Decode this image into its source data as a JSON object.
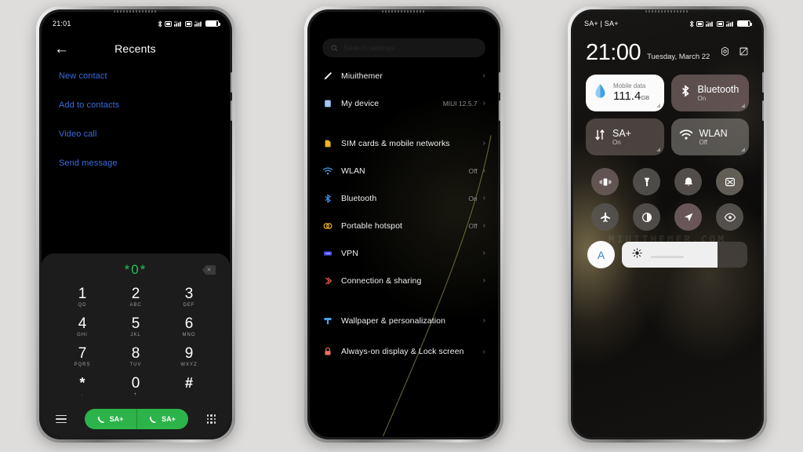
{
  "background_color": "#dedddb",
  "watermark": "MIUITHEMER.COM",
  "phone1": {
    "name": "dialer-recents-screen",
    "statusbar": {
      "time": "21:01",
      "icons": [
        "bluetooth-icon",
        "sim-icon",
        "signal-4g-icon",
        "sim-icon",
        "signal-4g-icon",
        "battery-icon"
      ]
    },
    "header": {
      "back": "←",
      "title": "Recents"
    },
    "links": [
      {
        "label": "New contact"
      },
      {
        "label": "Add to contacts"
      },
      {
        "label": "Video call"
      },
      {
        "label": "Send message"
      }
    ],
    "dialer": {
      "number": "*0*",
      "backspace_icon": "backspace-icon",
      "keys": [
        {
          "digit": "1",
          "letters": "QD"
        },
        {
          "digit": "2",
          "letters": "ABC"
        },
        {
          "digit": "3",
          "letters": "DEF"
        },
        {
          "digit": "4",
          "letters": "GHI"
        },
        {
          "digit": "5",
          "letters": "JKL"
        },
        {
          "digit": "6",
          "letters": "MNO"
        },
        {
          "digit": "7",
          "letters": "PQRS"
        },
        {
          "digit": "8",
          "letters": "TUV"
        },
        {
          "digit": "9",
          "letters": "WXYZ"
        },
        {
          "digit": "*",
          "letters": "."
        },
        {
          "digit": "0",
          "letters": "+"
        },
        {
          "digit": "#",
          "letters": ""
        }
      ],
      "call_sim1": "SA+",
      "call_sim2": "SA+",
      "call_color": "#2cb34a",
      "number_color": "#25c05a"
    }
  },
  "phone2": {
    "name": "settings-screen",
    "search": {
      "placeholder": "Search settings",
      "icon": "search-icon"
    },
    "items": [
      {
        "icon": "brush-icon",
        "label": "Miuithemer",
        "value": ""
      },
      {
        "icon": "device-icon",
        "label": "My device",
        "value": "MIUI 12.5.7"
      },
      {
        "icon": "sim-card-icon",
        "label": "SIM cards & mobile networks",
        "value": ""
      },
      {
        "icon": "wifi-icon",
        "label": "WLAN",
        "value": "Off"
      },
      {
        "icon": "bluetooth-icon",
        "label": "Bluetooth",
        "value": "On"
      },
      {
        "icon": "hotspot-icon",
        "label": "Portable hotspot",
        "value": "Off"
      },
      {
        "icon": "vpn-icon",
        "label": "VPN",
        "value": ""
      },
      {
        "icon": "sharing-icon",
        "label": "Connection & sharing",
        "value": ""
      },
      {
        "icon": "wallpaper-icon",
        "label": "Wallpaper & personalization",
        "value": ""
      },
      {
        "icon": "lock-icon",
        "label": "Always-on display & Lock screen",
        "value": ""
      }
    ],
    "chevron": "›"
  },
  "phone3": {
    "name": "control-center-screen",
    "statusbar": {
      "carrier": "SA+ | SA+",
      "icons": [
        "bluetooth-icon",
        "sim-icon",
        "signal-4g-icon",
        "sim-icon",
        "signal-4g-icon",
        "battery-icon"
      ]
    },
    "clock": {
      "time": "21:00",
      "date": "Tuesday, March 22"
    },
    "header_actions": [
      {
        "icon": "settings-gear-icon"
      },
      {
        "icon": "edit-icon"
      }
    ],
    "big_tiles": [
      {
        "icon": "data-drop-icon",
        "label": "Mobile data",
        "main": "111.4",
        "unit": "GB",
        "sub": "",
        "style": "light"
      },
      {
        "icon": "bluetooth-icon",
        "label": "",
        "main": "Bluetooth",
        "unit": "",
        "sub": "On",
        "style": "d1"
      },
      {
        "icon": "data-arrows-icon",
        "label": "",
        "main": "SA+",
        "unit": "",
        "sub": "On",
        "style": "d2"
      },
      {
        "icon": "wifi-icon",
        "label": "",
        "main": "WLAN",
        "unit": "",
        "sub": "Off",
        "style": "d3"
      }
    ],
    "toggles": [
      {
        "icon": "vibrate-icon",
        "on": true
      },
      {
        "icon": "flashlight-icon",
        "on": false
      },
      {
        "icon": "bell-icon",
        "on": false
      },
      {
        "icon": "screenshot-icon",
        "on": false
      },
      {
        "icon": "airplane-icon",
        "on": false
      },
      {
        "icon": "dark-mode-icon",
        "on": false
      },
      {
        "icon": "location-icon",
        "on": true
      },
      {
        "icon": "reading-eye-icon",
        "on": false
      }
    ],
    "brightness": {
      "auto_label": "A",
      "icon": "brightness-sun-icon",
      "percent": 76
    }
  }
}
